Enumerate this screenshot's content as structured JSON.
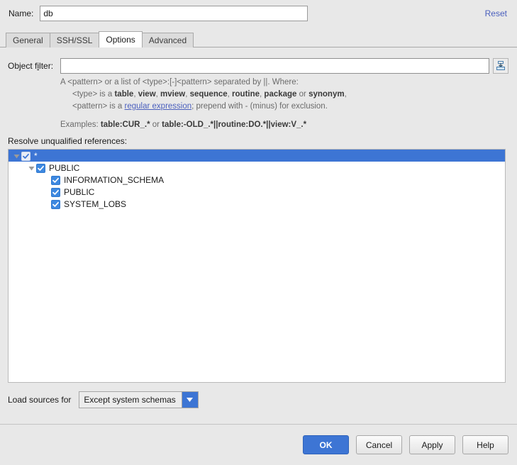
{
  "dialog": {
    "name_label": "Name:",
    "name_value": "db",
    "reset_label": "Reset"
  },
  "tabs": [
    {
      "label": "General",
      "active": false
    },
    {
      "label": "SSH/SSL",
      "active": false
    },
    {
      "label": "Options",
      "active": true
    },
    {
      "label": "Advanced",
      "active": false
    }
  ],
  "options": {
    "filter_label_pre": "Object f",
    "filter_label_mnemonic": "i",
    "filter_label_post": "lter:",
    "filter_value": "",
    "filter_placeholder": "",
    "import_icon": "import-filter-icon",
    "help": {
      "line1": "A <pattern> or a list of <type>:[-]<pattern> separated by ||. Where:",
      "line2_pre": "<type> is a ",
      "line2_types": [
        "table",
        "view",
        "mview",
        "sequence",
        "routine",
        "package"
      ],
      "line2_mid": " or ",
      "line2_last": "synonym",
      "line2_end": ",",
      "line3_pre": "<pattern> is a ",
      "line3_link": "regular expression",
      "line3_post": "; prepend with - (minus) for exclusion.",
      "line4_pre": "Examples: ",
      "line4_ex1": "table:CUR_.*",
      "line4_mid": " or ",
      "line4_ex2": "table:-OLD_.*||routine:DO.*||view:V_.*"
    },
    "resolve_label": "Resolve unqualified references:",
    "tree": [
      {
        "label": "*",
        "depth": 0,
        "checked": true,
        "expanded": true,
        "has_twisty": true,
        "selected": true
      },
      {
        "label": "PUBLIC",
        "depth": 1,
        "checked": true,
        "expanded": true,
        "has_twisty": true,
        "selected": false
      },
      {
        "label": "INFORMATION_SCHEMA",
        "depth": 2,
        "checked": true,
        "expanded": false,
        "has_twisty": false,
        "selected": false
      },
      {
        "label": "PUBLIC",
        "depth": 2,
        "checked": true,
        "expanded": false,
        "has_twisty": false,
        "selected": false
      },
      {
        "label": "SYSTEM_LOBS",
        "depth": 2,
        "checked": true,
        "expanded": false,
        "has_twisty": false,
        "selected": false
      }
    ],
    "load_sources_label": "Load sources for",
    "load_sources_value": "Except system schemas"
  },
  "footer": {
    "ok": "OK",
    "cancel": "Cancel",
    "apply": "Apply",
    "help": "Help"
  },
  "colors": {
    "accent": "#3d75d4",
    "link": "#4a5fbd",
    "checkbox": "#3d88e0",
    "background": "#e8e8e8"
  }
}
